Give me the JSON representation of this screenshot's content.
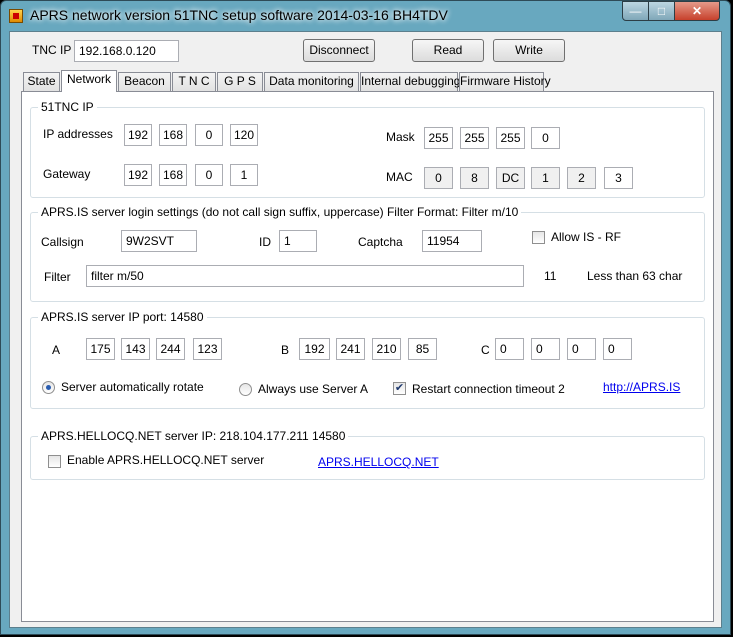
{
  "window": {
    "title": "APRS network version 51TNC setup software 2014-03-16 BH4TDV",
    "min_glyph": "—",
    "max_glyph": "□",
    "close_glyph": "✕"
  },
  "toolbar": {
    "tnc_ip_label": "TNC IP",
    "tnc_ip_value": "192.168.0.120",
    "disconnect_label": "Disconnect",
    "read_label": "Read",
    "write_label": "Write"
  },
  "tabs": [
    "State",
    "Network",
    "Beacon",
    "T N C",
    "G P S",
    "Data monitoring",
    "Internal debugging",
    "Firmware History"
  ],
  "active_tab": "Network",
  "tnc": {
    "group_title": "51TNC IP",
    "ip_label": "IP addresses",
    "ip": [
      "192",
      "168",
      "0",
      "120"
    ],
    "gateway_label": "Gateway",
    "gateway": [
      "192",
      "168",
      "0",
      "1"
    ],
    "mask_label": "Mask",
    "mask": [
      "255",
      "255",
      "255",
      "0"
    ],
    "mac_label": "MAC",
    "mac": [
      "0",
      "8",
      "DC",
      "1",
      "2",
      "3"
    ]
  },
  "login": {
    "group_title": "APRS.IS server login settings (do not call sign suffix, uppercase) Filter Format: Filter m/10",
    "callsign_label": "Callsign",
    "callsign": "9W2SVT",
    "id_label": "ID",
    "id": "1",
    "captcha_label": "Captcha",
    "captcha": "11954",
    "allow_label": "Allow IS - RF",
    "allow_checked": false,
    "filter_label": "Filter",
    "filter": "filter m/50",
    "filter_len": "11",
    "filter_hint": "Less than 63 char"
  },
  "servers": {
    "group_title": "APRS.IS server IP port: 14580",
    "a_label": "A",
    "a": [
      "175",
      "143",
      "244",
      "123"
    ],
    "b_label": "B",
    "b": [
      "192",
      "241",
      "210",
      "85"
    ],
    "c_label": "C",
    "c": [
      "0",
      "0",
      "0",
      "0"
    ],
    "rotate_label": "Server automatically rotate",
    "rotate_selected": true,
    "always_a_label": "Always use Server A",
    "always_a_selected": false,
    "restart_label": "Restart connection timeout 2",
    "restart_checked": true,
    "check_glyph": "✔",
    "link": "http://APRS.IS"
  },
  "hellocq": {
    "group_title": "APRS.HELLOCQ.NET server IP: 218.104.177.211 14580",
    "enable_label": "Enable APRS.HELLOCQ.NET server",
    "enable_checked": false,
    "link": "APRS.HELLOCQ.NET"
  }
}
